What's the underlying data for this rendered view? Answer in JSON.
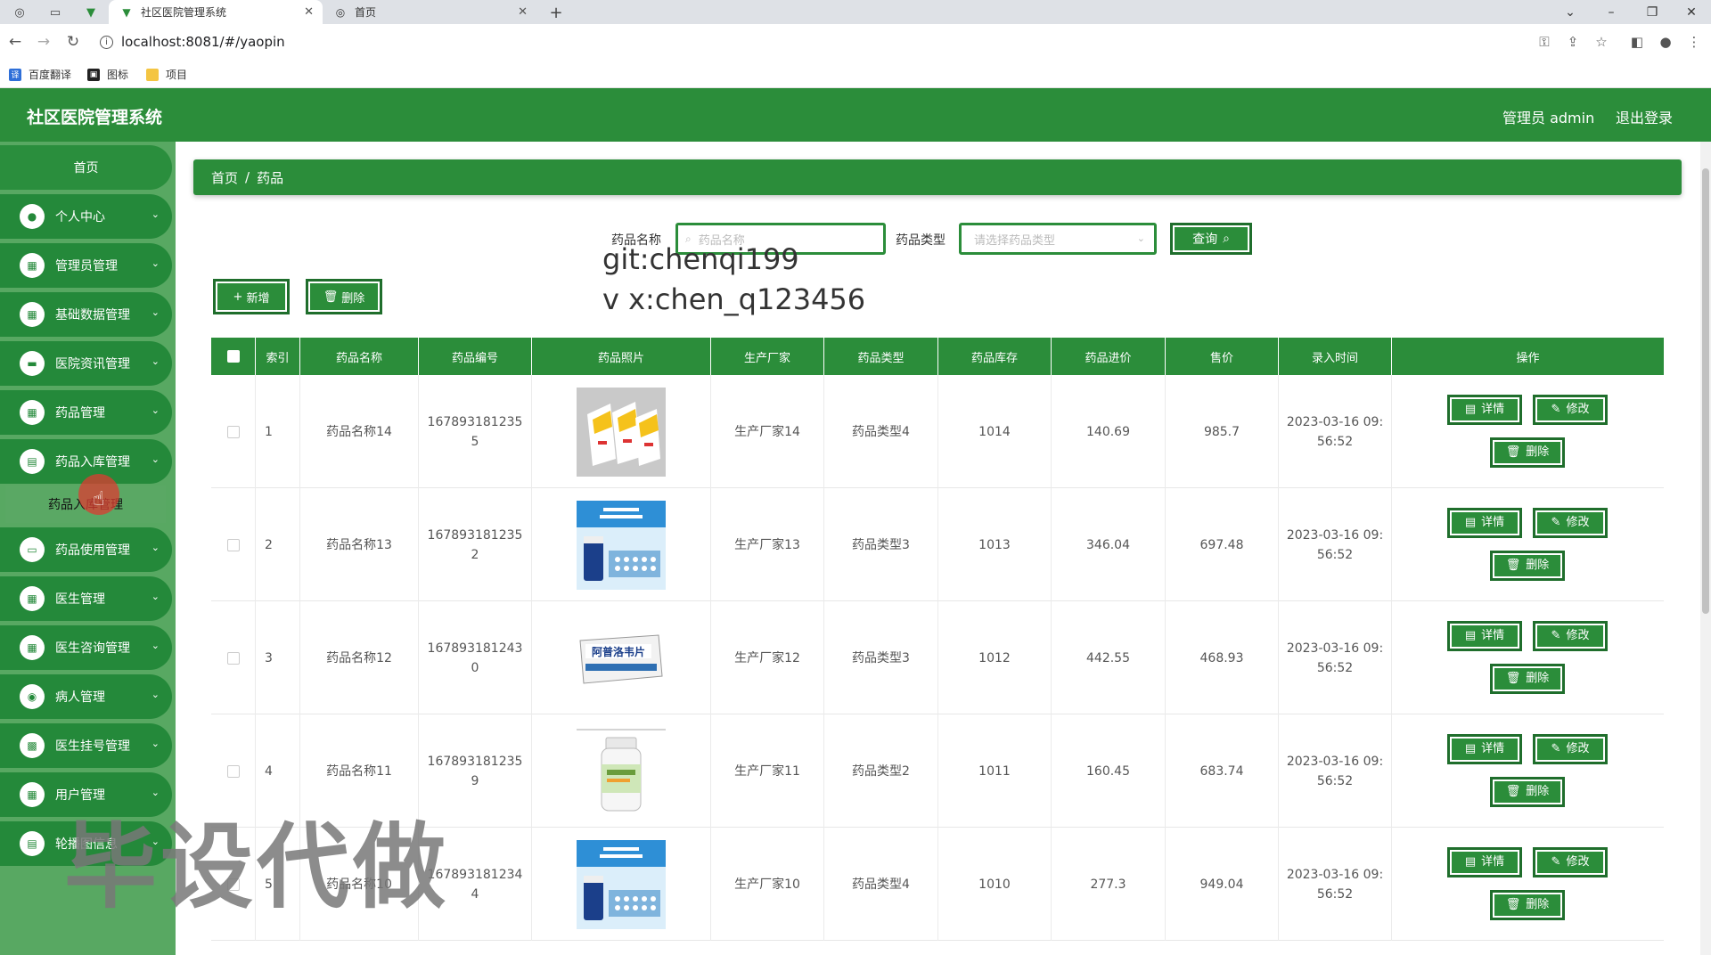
{
  "browser": {
    "tabs": [
      {
        "title": "社区医院管理系统",
        "active": true
      },
      {
        "title": "首页",
        "active": false
      }
    ],
    "url": "localhost:8081/#/yaopin",
    "bookmarks": [
      "百度翻译",
      "图标",
      "项目"
    ]
  },
  "header": {
    "title": "社区医院管理系统",
    "user": "管理员 admin",
    "logout": "退出登录"
  },
  "sidebar": {
    "home": "首页",
    "items": [
      {
        "label": "个人中心"
      },
      {
        "label": "管理员管理"
      },
      {
        "label": "基础数据管理"
      },
      {
        "label": "医院资讯管理"
      },
      {
        "label": "药品管理"
      },
      {
        "label": "药品入库管理"
      },
      {
        "label": "药品使用管理"
      },
      {
        "label": "医生管理"
      },
      {
        "label": "医生咨询管理"
      },
      {
        "label": "病人管理"
      },
      {
        "label": "医生挂号管理"
      },
      {
        "label": "用户管理"
      },
      {
        "label": "轮播图信息"
      }
    ],
    "submenu": "药品入库管理"
  },
  "breadcrumb": {
    "home": "首页",
    "sep": "/",
    "current": "药品"
  },
  "search": {
    "name_label": "药品名称",
    "name_placeholder": "药品名称",
    "type_label": "药品类型",
    "type_placeholder": "请选择药品类型",
    "query_button": "查询"
  },
  "actions": {
    "add": "新增",
    "delete": "删除"
  },
  "watermark": {
    "line1": "git:chenqi199",
    "line2": "v x:chen_q123456",
    "big": "毕设代做"
  },
  "table": {
    "columns": [
      "索引",
      "药品名称",
      "药品编号",
      "药品照片",
      "生产厂家",
      "药品类型",
      "药品库存",
      "药品进价",
      "售价",
      "录入时间",
      "操作"
    ],
    "row_buttons": {
      "detail": "详情",
      "edit": "修改",
      "delete": "删除"
    },
    "rows": [
      {
        "index": "1",
        "name": "药品名称14",
        "code1": "167893181235",
        "code2": "5",
        "maker": "生产厂家14",
        "type": "药品类型4",
        "stock": "1014",
        "cost": "140.69",
        "price": "985.7",
        "time1": "2023-03-16 09:",
        "time2": "56:52",
        "img": "box-yellow"
      },
      {
        "index": "2",
        "name": "药品名称13",
        "code1": "167893181235",
        "code2": "2",
        "maker": "生产厂家13",
        "type": "药品类型3",
        "stock": "1013",
        "cost": "346.04",
        "price": "697.48",
        "time1": "2023-03-16 09:",
        "time2": "56:52",
        "img": "box-blue"
      },
      {
        "index": "3",
        "name": "药品名称12",
        "code1": "167893181243",
        "code2": "0",
        "maker": "生产厂家12",
        "type": "药品类型3",
        "stock": "1012",
        "cost": "442.55",
        "price": "468.93",
        "time1": "2023-03-16 09:",
        "time2": "56:52",
        "img": "box-white",
        "img_text": "阿普洛韦片"
      },
      {
        "index": "4",
        "name": "药品名称11",
        "code1": "167893181235",
        "code2": "9",
        "maker": "生产厂家11",
        "type": "药品类型2",
        "stock": "1011",
        "cost": "160.45",
        "price": "683.74",
        "time1": "2023-03-16 09:",
        "time2": "56:52",
        "img": "bottle"
      },
      {
        "index": "5",
        "name": "药品名称10",
        "code1": "167893181234",
        "code2": "4",
        "maker": "生产厂家10",
        "type": "药品类型4",
        "stock": "1010",
        "cost": "277.3",
        "price": "949.04",
        "time1": "2023-03-16 09:",
        "time2": "56:52",
        "img": "box-blue"
      }
    ]
  },
  "colors": {
    "primary": "#2b8d3a",
    "sidebar_bg": "#58a862",
    "sidebar_item": "#24893a"
  }
}
